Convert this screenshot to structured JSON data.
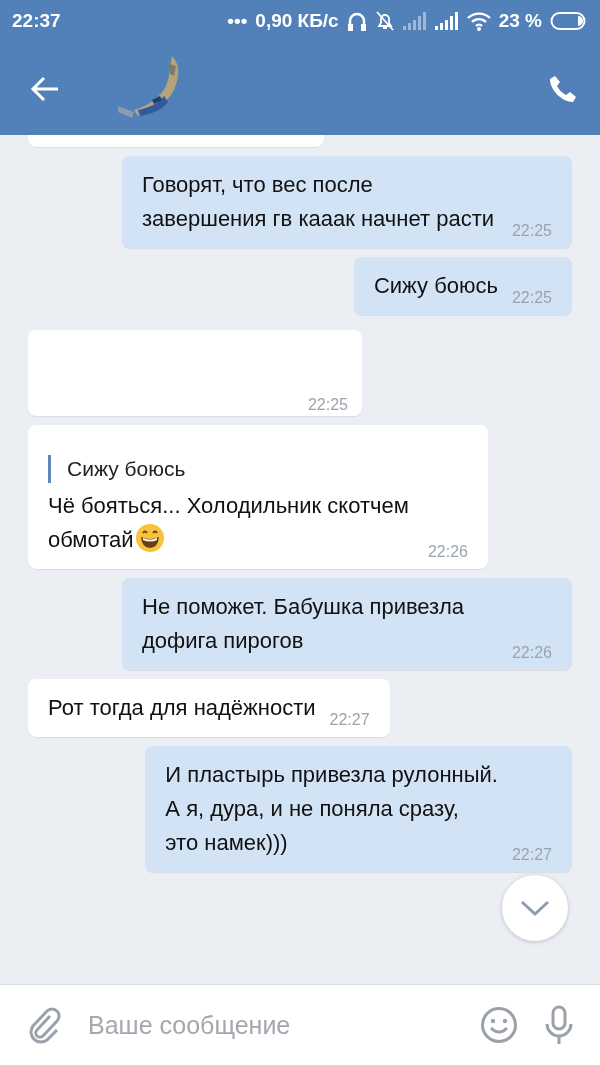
{
  "status_bar": {
    "time": "22:37",
    "dots": "•••",
    "speed": "0,90 КБ/с",
    "battery": "23 %"
  },
  "messages": [
    {
      "kind": "incoming",
      "cut": true
    },
    {
      "kind": "outgoing",
      "text": "Говорят, что вес после завершения гв кааак начнет расти",
      "time": "22:25"
    },
    {
      "kind": "outgoing",
      "text": "Сижу боюсь",
      "time": "22:25"
    },
    {
      "kind": "incoming",
      "redacted": true,
      "time": "22:25"
    },
    {
      "kind": "incoming",
      "quote": "Сижу боюсь",
      "text": "Чё бояться... Холодильник скотчем обмотай",
      "emoji": true,
      "time": "22:26"
    },
    {
      "kind": "outgoing",
      "text": "Не поможет. Бабушка привезла дофига пирогов",
      "time": "22:26"
    },
    {
      "kind": "incoming",
      "text": "Рот тогда для надёжности",
      "time": "22:27"
    },
    {
      "kind": "outgoing",
      "text": "И пластырь привезла рулонный.\nА я, дура, и не поняла сразу,\nэто намек)))",
      "time": "22:27"
    }
  ],
  "composer": {
    "placeholder": "Ваше сообщение"
  }
}
